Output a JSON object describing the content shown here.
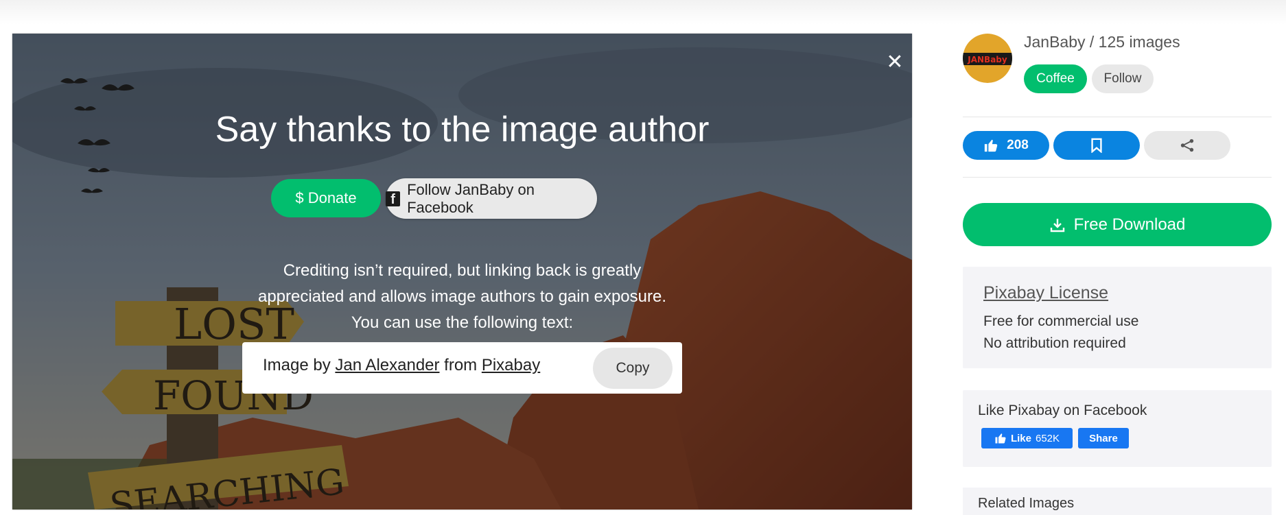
{
  "modal": {
    "title": "Say thanks to the image author",
    "donate_label": "$ Donate",
    "facebook_follow_label": "Follow JanBaby on Facebook",
    "credit_lines": [
      "Crediting isn’t required, but linking back is greatly",
      "appreciated and allows image authors to gain exposure.",
      "You can use the following text:"
    ],
    "attribution": {
      "prefix": "Image by",
      "author_link": "Jan Alexander",
      "middle": "from",
      "site_link": "Pixabay"
    },
    "copy_label": "Copy",
    "close_symbol": "✕"
  },
  "image": {
    "sign_words": [
      "LOST",
      "FOUND",
      "SEARCHING"
    ]
  },
  "author": {
    "avatar_text": "JANBaby",
    "line": "JanBaby / 125 images",
    "coffee_label": "Coffee",
    "follow_label": "Follow"
  },
  "actions": {
    "like_count": "208",
    "icons": [
      "thumbs-up-icon",
      "bookmark-icon",
      "share-icon",
      "download-icon"
    ]
  },
  "download": {
    "label": "Free Download"
  },
  "license": {
    "title": "Pixabay License",
    "lines": [
      "Free for commercial use",
      "No attribution required"
    ]
  },
  "facebook": {
    "title": "Like Pixabay on Facebook",
    "like_label": "Like",
    "like_count": "652K",
    "share_label": "Share"
  },
  "related": {
    "title": "Related Images"
  },
  "colors": {
    "green": "#02be6e",
    "blue": "#0a84e0",
    "facebook_blue": "#1877f2",
    "panel_bg": "#f4f4f7"
  }
}
